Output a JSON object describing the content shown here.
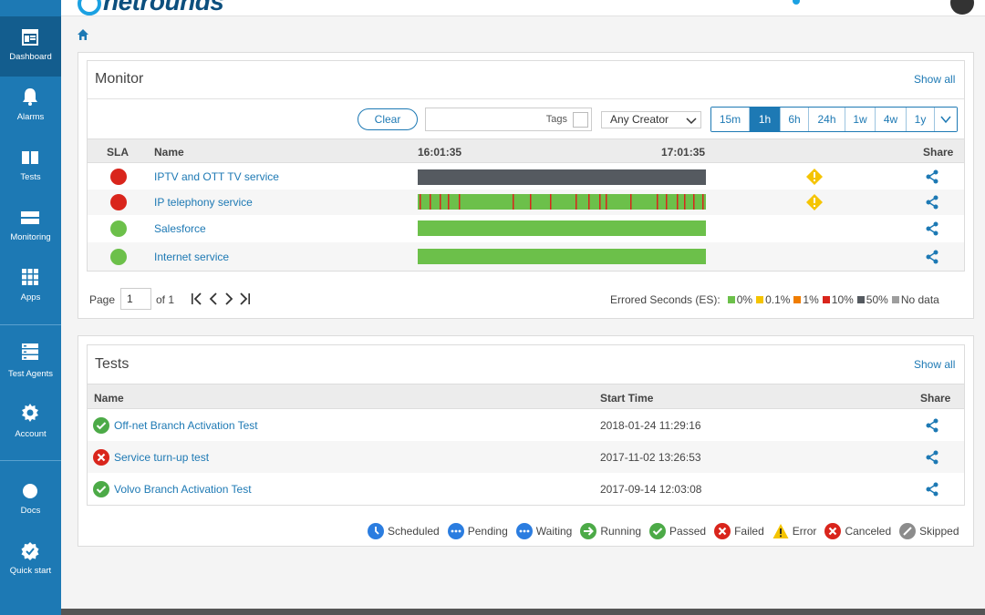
{
  "brand": {
    "logo_text": "netrounds"
  },
  "sidebar": {
    "items": [
      {
        "label": "Dashboard",
        "icon": "dashboard-icon",
        "active": true
      },
      {
        "label": "Alarms",
        "icon": "bell-icon"
      },
      {
        "label": "Tests",
        "icon": "tests-icon"
      },
      {
        "label": "Monitoring",
        "icon": "monitoring-icon"
      },
      {
        "label": "Apps",
        "icon": "apps-grid-icon"
      },
      {
        "label": "Test Agents",
        "icon": "server-icon"
      },
      {
        "label": "Account",
        "icon": "gear-icon"
      },
      {
        "label": "Docs",
        "icon": "docs-icon"
      },
      {
        "label": "Quick start",
        "icon": "quickstart-badge-icon"
      }
    ]
  },
  "monitor": {
    "title": "Monitor",
    "show_all": "Show all",
    "clear_label": "Clear",
    "tags_label": "Tags",
    "creator_value": "Any Creator",
    "ranges": [
      {
        "label": "15m",
        "active": false
      },
      {
        "label": "1h",
        "active": true
      },
      {
        "label": "6h",
        "active": false
      },
      {
        "label": "24h",
        "active": false
      },
      {
        "label": "1w",
        "active": false
      },
      {
        "label": "4w",
        "active": false
      },
      {
        "label": "1y",
        "active": false
      }
    ],
    "columns": {
      "sla": "SLA",
      "name": "Name",
      "time_start": "16:01:35",
      "time_end": "17:01:35",
      "share": "Share"
    },
    "rows": [
      {
        "name": "IPTV and OTT TV service",
        "sla": "red",
        "bar": "nodata",
        "warning": true
      },
      {
        "name": "IP telephony service",
        "sla": "red",
        "bar": "errors",
        "warning": true
      },
      {
        "name": "Salesforce",
        "sla": "green",
        "bar": "ok",
        "warning": false
      },
      {
        "name": "Internet service",
        "sla": "green",
        "bar": "ok",
        "warning": false
      }
    ],
    "pager": {
      "page_label": "Page",
      "page_value": "1",
      "of_label": "of 1"
    },
    "legend": {
      "label": "Errored Seconds (ES):",
      "items": [
        {
          "label": "0%",
          "color": "#6cc04a"
        },
        {
          "label": "0.1%",
          "color": "#f5c400"
        },
        {
          "label": "1%",
          "color": "#f07d00"
        },
        {
          "label": "10%",
          "color": "#d9251c"
        },
        {
          "label": "50%",
          "color": "#555a60"
        },
        {
          "label": "No data",
          "color": "#9e9e9e"
        }
      ]
    }
  },
  "tests": {
    "title": "Tests",
    "show_all": "Show all",
    "columns": {
      "name": "Name",
      "start_time": "Start Time",
      "share": "Share"
    },
    "rows": [
      {
        "name": "Off-net Branch Activation Test",
        "status": "passed",
        "start_time": "2018-01-24 11:29:16"
      },
      {
        "name": "Service turn-up test",
        "status": "failed",
        "start_time": "2017-11-02 13:26:53"
      },
      {
        "name": "Volvo Branch Activation Test",
        "status": "passed",
        "start_time": "2017-09-14 12:03:08"
      }
    ],
    "status_legend": [
      {
        "label": "Scheduled",
        "icon": "clock-icon"
      },
      {
        "label": "Pending",
        "icon": "pending-icon"
      },
      {
        "label": "Waiting",
        "icon": "waiting-icon"
      },
      {
        "label": "Running",
        "icon": "running-arrow-icon"
      },
      {
        "label": "Passed",
        "icon": "passed-check-icon"
      },
      {
        "label": "Failed",
        "icon": "failed-x-icon"
      },
      {
        "label": "Error",
        "icon": "error-warning-icon"
      },
      {
        "label": "Canceled",
        "icon": "canceled-x-icon"
      },
      {
        "label": "Skipped",
        "icon": "skipped-icon"
      }
    ]
  },
  "colors": {
    "accent": "#1d79b4",
    "sidebar": "#1d79b4",
    "ok": "#6cc04a",
    "fail": "#d9251c",
    "warn": "#f5c400"
  }
}
